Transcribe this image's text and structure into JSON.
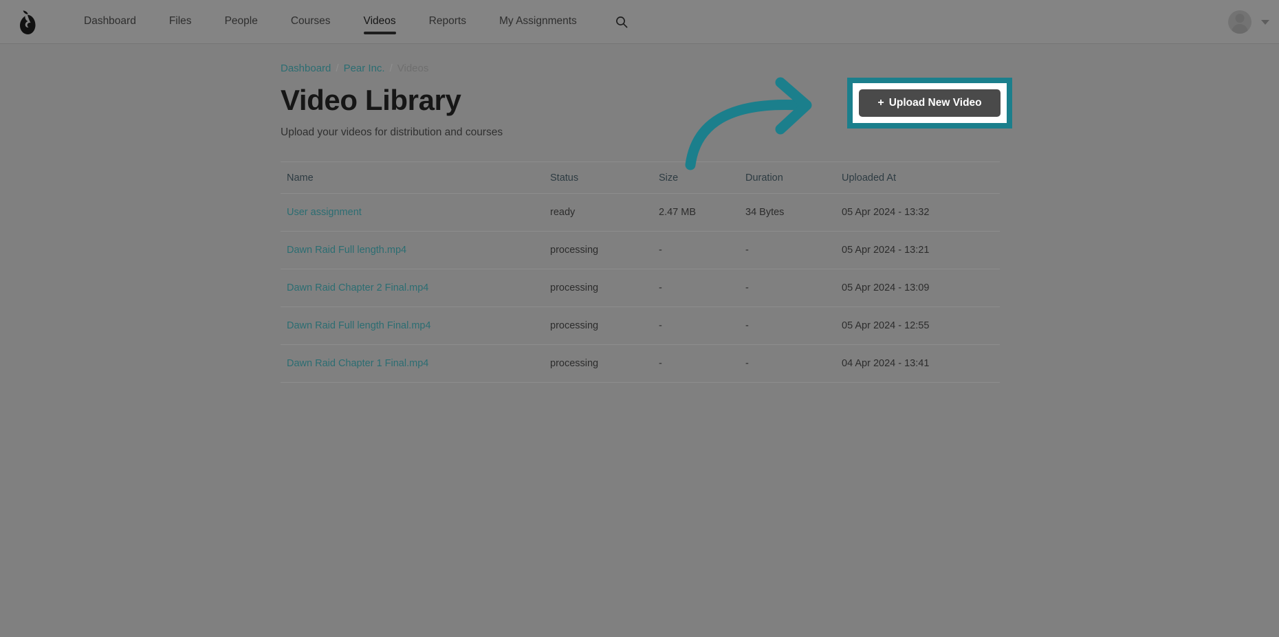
{
  "app": {
    "logo_icon": "pear-logo-icon",
    "accent_color": "#1b7f8c",
    "link_color": "#2b6d72",
    "button_color": "#4a4a4a"
  },
  "nav": {
    "items": [
      {
        "label": "Dashboard",
        "active": false
      },
      {
        "label": "Files",
        "active": false
      },
      {
        "label": "People",
        "active": false
      },
      {
        "label": "Courses",
        "active": false
      },
      {
        "label": "Videos",
        "active": true
      },
      {
        "label": "Reports",
        "active": false
      },
      {
        "label": "My Assignments",
        "active": false
      }
    ],
    "search_icon": "search-icon",
    "avatar_icon": "user-avatar-icon",
    "caret_icon": "chevron-down-icon"
  },
  "breadcrumb": {
    "items": [
      "Dashboard",
      "Pear Inc.",
      "Videos"
    ],
    "separator": "/"
  },
  "header": {
    "title": "Video Library",
    "subtitle": "Upload your videos for distribution and courses"
  },
  "upload_button": {
    "plus": "+",
    "label": "Upload New Video",
    "highlighted": true
  },
  "annotation": {
    "arrow_icon": "curved-arrow-icon",
    "arrow_color": "#1b7f8c",
    "points_to": "upload-new-video-button"
  },
  "table": {
    "columns": [
      "Name",
      "Status",
      "Size",
      "Duration",
      "Uploaded At"
    ],
    "rows": [
      {
        "name": "User assignment",
        "status": "ready",
        "size": "2.47 MB",
        "duration": "34 Bytes",
        "uploaded_at": "05 Apr 2024 - 13:32"
      },
      {
        "name": "Dawn Raid Full length.mp4",
        "status": "processing",
        "size": "-",
        "duration": "-",
        "uploaded_at": "05 Apr 2024 - 13:21"
      },
      {
        "name": "Dawn Raid Chapter 2 Final.mp4",
        "status": "processing",
        "size": "-",
        "duration": "-",
        "uploaded_at": "05 Apr 2024 - 13:09"
      },
      {
        "name": "Dawn Raid Full length Final.mp4",
        "status": "processing",
        "size": "-",
        "duration": "-",
        "uploaded_at": "05 Apr 2024 - 12:55"
      },
      {
        "name": "Dawn Raid Chapter 1 Final.mp4",
        "status": "processing",
        "size": "-",
        "duration": "-",
        "uploaded_at": "04 Apr 2024 - 13:41"
      }
    ]
  }
}
